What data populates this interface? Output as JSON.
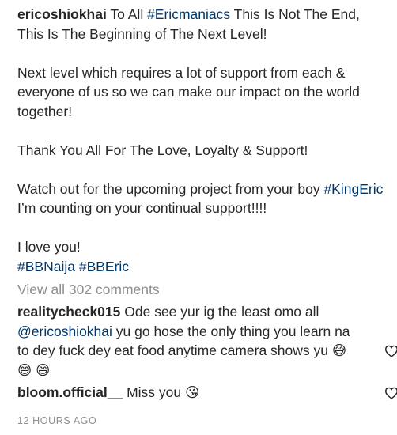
{
  "post": {
    "username": "ericoshiokhai",
    "caption_intro": " To All ",
    "tag_ericmaniacs": "#Ericmaniacs",
    "caption_line1_rest": " This Is Not The End, This Is The Beginning of The Next Level!",
    "paragraph2": "Next level which requires a lot of support from each & everyone of us so we can make our impact on the world together!",
    "paragraph3": "Thank You All For The Love, Loyalty & Support!",
    "paragraph4_start": "Watch out for the upcoming project from your boy ",
    "tag_kingeric": "#KingEric",
    "paragraph4_rest": " I’m counting on your continual support!!!!",
    "paragraph5": "I love you!",
    "tag_bbnaija": "#BBNaija",
    "tag_bberic": "#BBEric"
  },
  "view_all_comments": "View all 302 comments",
  "comments": [
    {
      "username": "realitycheck015",
      "text": " Ode see yur ig the least omo all ",
      "mention": "@ericoshiokhai",
      "text_rest": " yu go hose the only thing you learn na to dey fuck dey eat food anytime camera shows yu ",
      "emojis": "😅 😅 😅"
    },
    {
      "username": "bloom.official__",
      "text": " Miss you ",
      "emojis": "😘"
    }
  ],
  "timestamp": "12 HOURS AGO",
  "colors": {
    "text": "#262626",
    "link": "#00376b",
    "muted": "#8e8e8e"
  },
  "icons": {
    "like": "heart-outline-icon"
  }
}
